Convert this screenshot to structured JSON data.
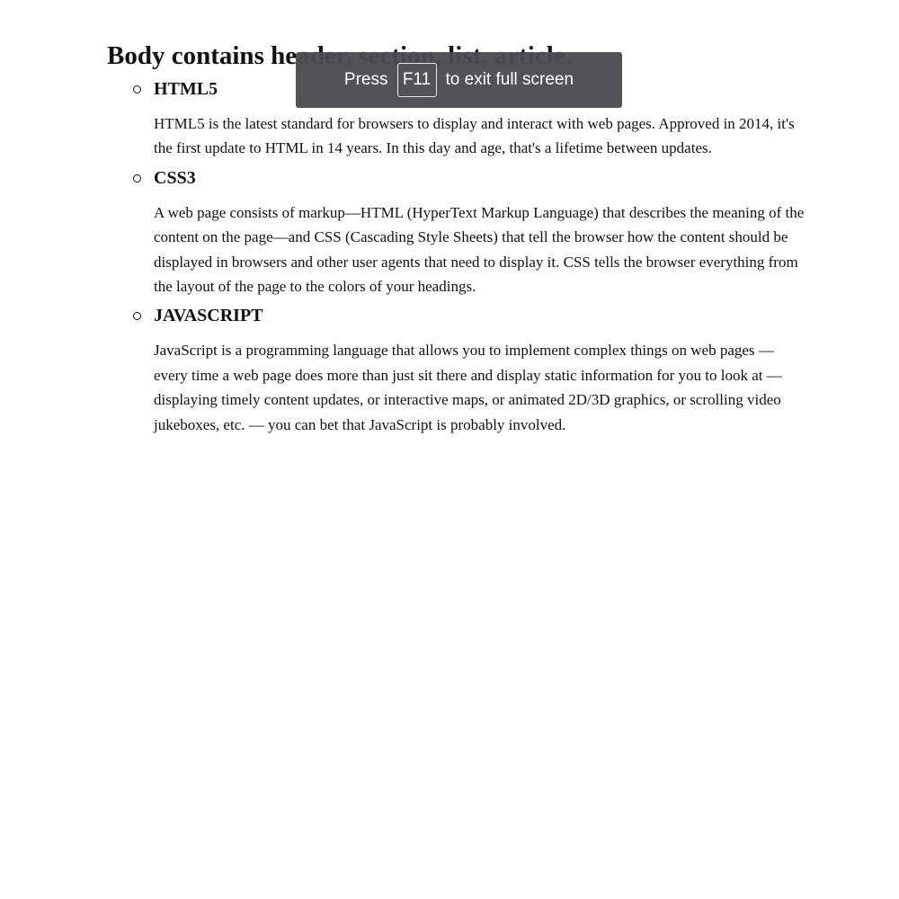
{
  "page": {
    "title": "Body contains header, section, list, article."
  },
  "topics": [
    {
      "title": "HTML5",
      "text": "HTML5 is the latest standard for browsers to display and interact with web pages. Approved in 2014, it's the first update to HTML in 14 years. In this day and age, that's a lifetime between updates."
    },
    {
      "title": "CSS3",
      "text": "A web page consists of markup—HTML (HyperText Markup Language) that describes the meaning of the content on the page—and CSS (Cascading Style Sheets) that tell the browser how the content should be displayed in browsers and other user agents that need to display it. CSS tells the browser everything from the layout of the page to the colors of your headings."
    },
    {
      "title": "JAVASCRIPT",
      "text": "JavaScript is a programming language that allows you to implement complex things on web pages — every time a web page does more than just sit there and display static information for you to look at — displaying timely content updates, or interactive maps, or animated 2D/3D graphics, or scrolling video jukeboxes, etc. — you can bet that JavaScript is probably involved."
    }
  ],
  "fullscreen_toast": {
    "prefix": "Press",
    "key": "F11",
    "suffix": "to exit full screen"
  },
  "colors": {
    "text": "#111111",
    "toast_background": "#4a4c50",
    "toast_text": "#ffffff"
  }
}
